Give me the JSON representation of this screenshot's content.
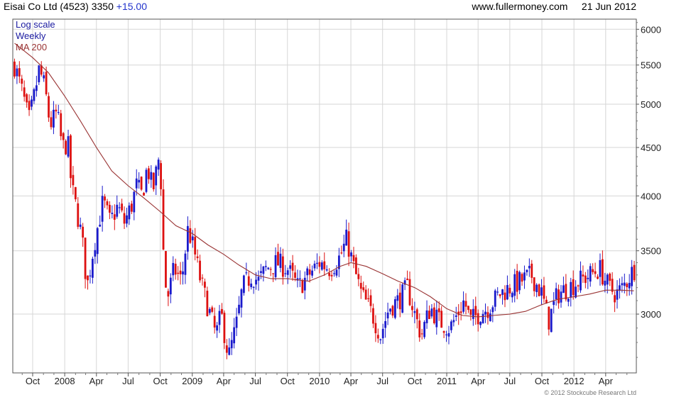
{
  "header": {
    "ticker": "Eisai Co Ltd (4523)",
    "price": "3350",
    "change": "+15.00",
    "site": "www.fullermoney.com",
    "date": "21 Jun 2012"
  },
  "footer": {
    "copyright": "© 2012 Stockcube Research Ltd"
  },
  "colors": {
    "up": "#1a1acc",
    "down": "#dd1111",
    "ma": "#993333",
    "grid": "#d6d6d6",
    "legend_blue": "#1a1aa0",
    "legend_red": "#993333"
  },
  "chart_data": {
    "type": "candlestick",
    "frequency": "Weekly",
    "scale": "log",
    "legend": [
      "Log scale",
      "Weekly",
      "MA 200"
    ],
    "legend_position": "top-left",
    "grid": true,
    "ylim": [
      2600,
      6150
    ],
    "y_ticks": [
      3000,
      3500,
      4000,
      4500,
      5000,
      5500,
      6000
    ],
    "x_ticks": [
      "Oct",
      "2008",
      "Apr",
      "Jul",
      "Oct",
      "2009",
      "Apr",
      "Jul",
      "Oct",
      "2010",
      "Apr",
      "Jul",
      "Oct",
      "2011",
      "Apr",
      "Jul",
      "Oct",
      "2012",
      "Apr"
    ],
    "series": [
      {
        "name": "Weekly",
        "type": "candlestick",
        "close_path": [
          [
            "2007-08-10",
            5500
          ],
          [
            "2007-09-01",
            5150
          ],
          [
            "2007-09-20",
            4800
          ],
          [
            "2007-10-01",
            5000
          ],
          [
            "2007-10-20",
            5450
          ],
          [
            "2007-11-05",
            5200
          ],
          [
            "2007-11-20",
            4750
          ],
          [
            "2007-12-10",
            4900
          ],
          [
            "2007-12-25",
            4500
          ],
          [
            "2008-01-10",
            4550
          ],
          [
            "2008-01-20",
            4100
          ],
          [
            "2008-02-05",
            3850
          ],
          [
            "2008-02-20",
            3600
          ],
          [
            "2008-03-05",
            3200
          ],
          [
            "2008-03-25",
            3550
          ],
          [
            "2008-04-20",
            3950
          ],
          [
            "2008-05-10",
            3750
          ],
          [
            "2008-06-01",
            3900
          ],
          [
            "2008-06-20",
            3750
          ],
          [
            "2008-07-10",
            3900
          ],
          [
            "2008-07-25",
            4100
          ],
          [
            "2008-08-10",
            4000
          ],
          [
            "2008-08-25",
            4300
          ],
          [
            "2008-09-10",
            4050
          ],
          [
            "2008-09-30",
            4450
          ],
          [
            "2008-10-10",
            3500
          ],
          [
            "2008-10-20",
            3100
          ],
          [
            "2008-11-10",
            3350
          ],
          [
            "2008-12-01",
            3250
          ],
          [
            "2008-12-20",
            3700
          ],
          [
            "2009-01-10",
            3450
          ],
          [
            "2009-01-25",
            3250
          ],
          [
            "2009-02-15",
            3050
          ],
          [
            "2009-03-10",
            2850
          ],
          [
            "2009-03-25",
            3000
          ],
          [
            "2009-04-15",
            2700
          ],
          [
            "2009-05-10",
            2950
          ],
          [
            "2009-05-25",
            3200
          ],
          [
            "2009-06-20",
            3300
          ],
          [
            "2009-07-10",
            3250
          ],
          [
            "2009-08-01",
            3350
          ],
          [
            "2009-09-01",
            3400
          ],
          [
            "2009-10-01",
            3350
          ],
          [
            "2009-11-01",
            3200
          ],
          [
            "2009-12-01",
            3300
          ],
          [
            "2010-01-01",
            3400
          ],
          [
            "2010-02-01",
            3350
          ],
          [
            "2010-03-01",
            3450
          ],
          [
            "2010-03-20",
            3600
          ],
          [
            "2010-04-10",
            3350
          ],
          [
            "2010-05-01",
            3150
          ],
          [
            "2010-06-01",
            3000
          ],
          [
            "2010-06-25",
            2850
          ],
          [
            "2010-07-20",
            3050
          ],
          [
            "2010-08-15",
            3100
          ],
          [
            "2010-09-10",
            3200
          ],
          [
            "2010-10-01",
            3000
          ],
          [
            "2010-10-20",
            2850
          ],
          [
            "2010-11-15",
            3050
          ],
          [
            "2010-12-10",
            2950
          ],
          [
            "2011-01-10",
            2900
          ],
          [
            "2011-02-01",
            3000
          ],
          [
            "2011-02-20",
            3100
          ],
          [
            "2011-03-10",
            2950
          ],
          [
            "2011-04-01",
            3000
          ],
          [
            "2011-05-01",
            3050
          ],
          [
            "2011-06-01",
            3150
          ],
          [
            "2011-07-01",
            3200
          ],
          [
            "2011-08-01",
            3250
          ],
          [
            "2011-09-01",
            3300
          ],
          [
            "2011-10-01",
            3150
          ],
          [
            "2011-10-20",
            2950
          ],
          [
            "2011-11-15",
            3150
          ],
          [
            "2011-12-15",
            3200
          ],
          [
            "2012-01-15",
            3250
          ],
          [
            "2012-02-15",
            3300
          ],
          [
            "2012-03-15",
            3350
          ],
          [
            "2012-04-10",
            3200
          ],
          [
            "2012-05-01",
            3150
          ],
          [
            "2012-05-20",
            3200
          ],
          [
            "2012-06-21",
            3350
          ]
        ]
      },
      {
        "name": "MA 200",
        "type": "line",
        "points": [
          [
            "2007-08-10",
            5800
          ],
          [
            "2007-10-01",
            5600
          ],
          [
            "2007-11-15",
            5400
          ],
          [
            "2008-01-01",
            5100
          ],
          [
            "2008-02-15",
            4800
          ],
          [
            "2008-04-01",
            4500
          ],
          [
            "2008-05-15",
            4250
          ],
          [
            "2008-07-01",
            4100
          ],
          [
            "2008-08-15",
            3980
          ],
          [
            "2008-10-01",
            3850
          ],
          [
            "2008-11-15",
            3720
          ],
          [
            "2009-01-01",
            3650
          ],
          [
            "2009-02-15",
            3550
          ],
          [
            "2009-04-01",
            3470
          ],
          [
            "2009-05-15",
            3380
          ],
          [
            "2009-07-01",
            3300
          ],
          [
            "2009-08-15",
            3270
          ],
          [
            "2009-10-01",
            3270
          ],
          [
            "2009-12-01",
            3250
          ],
          [
            "2010-01-15",
            3300
          ],
          [
            "2010-03-01",
            3370
          ],
          [
            "2010-04-01",
            3400
          ],
          [
            "2010-05-15",
            3370
          ],
          [
            "2010-07-01",
            3310
          ],
          [
            "2010-08-15",
            3250
          ],
          [
            "2010-10-01",
            3200
          ],
          [
            "2010-11-15",
            3130
          ],
          [
            "2011-01-01",
            3040
          ],
          [
            "2011-02-15",
            2990
          ],
          [
            "2011-04-01",
            2980
          ],
          [
            "2011-05-15",
            2990
          ],
          [
            "2011-07-01",
            3000
          ],
          [
            "2011-08-15",
            3020
          ],
          [
            "2011-10-01",
            3070
          ],
          [
            "2011-11-15",
            3110
          ],
          [
            "2012-01-01",
            3130
          ],
          [
            "2012-02-15",
            3150
          ],
          [
            "2012-04-01",
            3180
          ],
          [
            "2012-05-15",
            3180
          ],
          [
            "2012-06-21",
            3175
          ]
        ]
      }
    ]
  }
}
